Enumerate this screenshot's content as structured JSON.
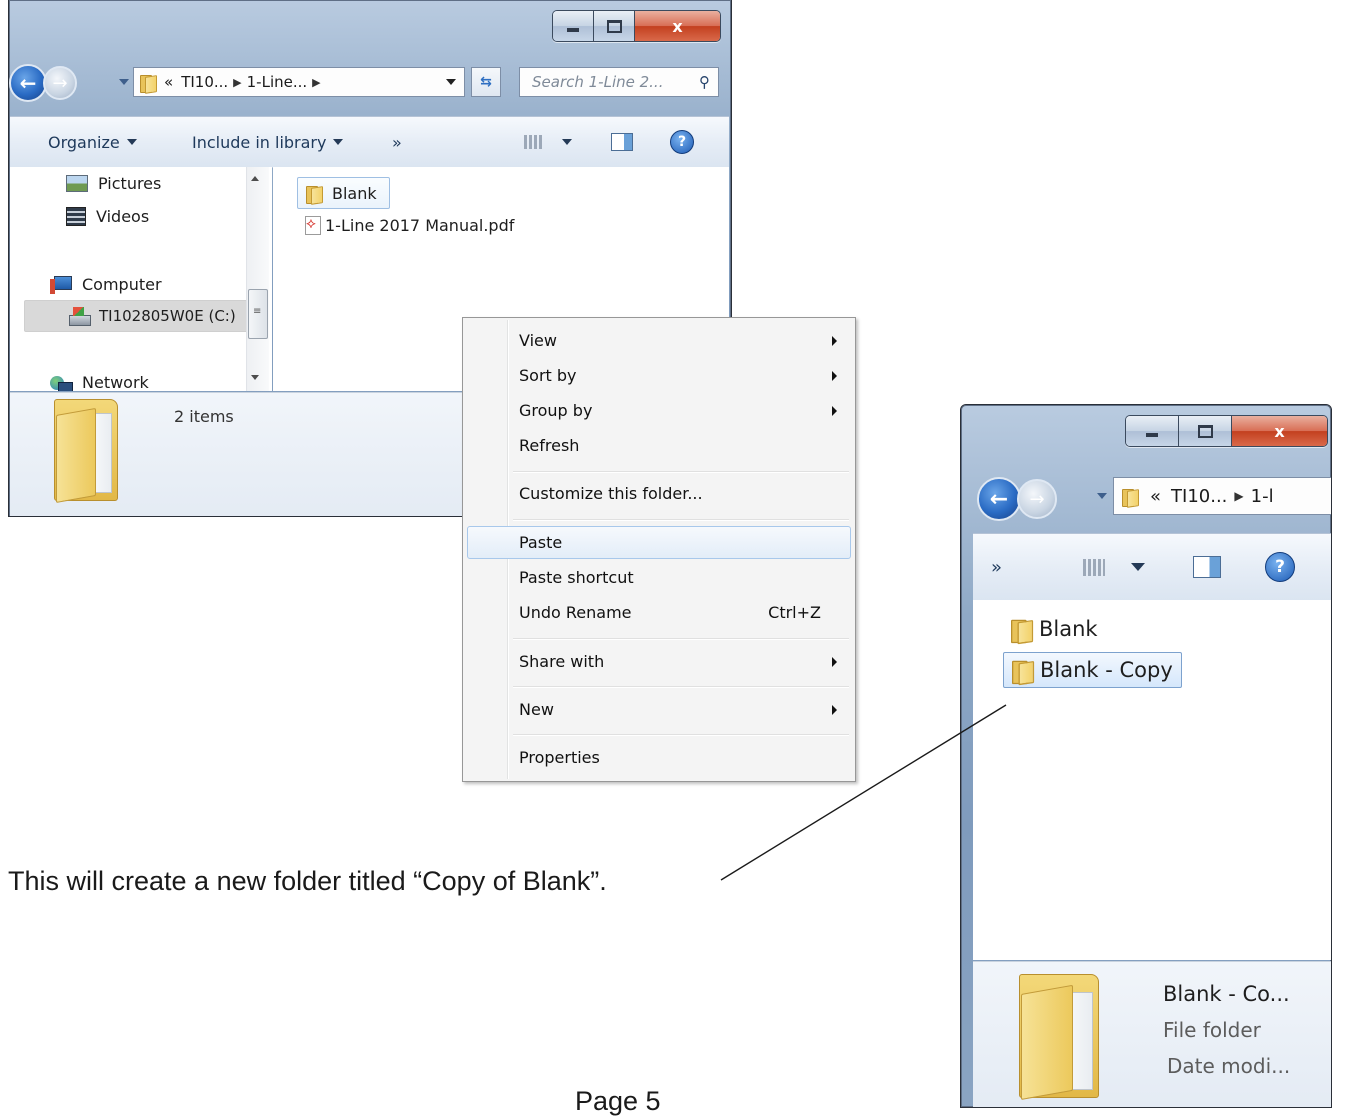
{
  "window1": {
    "address_overflow": "«",
    "address_crumbs": [
      "TI10...",
      "1-Line..."
    ],
    "search_placeholder": "Search 1-Line 2...",
    "toolbar": {
      "organize": "Organize",
      "include_in_library": "Include in library",
      "more": "»"
    },
    "nav_tree": {
      "pictures": "Pictures",
      "videos": "Videos",
      "computer": "Computer",
      "drive": "TI102805W0E (C:)",
      "network": "Network"
    },
    "files": [
      {
        "name": "Blank",
        "type": "folder"
      },
      {
        "name": "1-Line 2017 Manual.pdf",
        "type": "pdf"
      }
    ],
    "status": {
      "item_count": "2 items"
    },
    "caption_buttons": {
      "close": "x"
    }
  },
  "context_menu": {
    "items": [
      {
        "label": "View",
        "submenu": true
      },
      {
        "label": "Sort by",
        "submenu": true
      },
      {
        "label": "Group by",
        "submenu": true
      },
      {
        "label": "Refresh"
      },
      {
        "label": "Customize this folder..."
      },
      {
        "label": "Paste",
        "highlighted": true
      },
      {
        "label": "Paste shortcut"
      },
      {
        "label": "Undo Rename",
        "shortcut": "Ctrl+Z"
      },
      {
        "label": "Share with",
        "submenu": true
      },
      {
        "label": "New",
        "submenu": true
      },
      {
        "label": "Properties"
      }
    ]
  },
  "window2": {
    "address_overflow": "«",
    "address_crumbs": [
      "TI10...",
      "1-l"
    ],
    "toolbar": {
      "more": "»"
    },
    "files": [
      {
        "name": "Blank",
        "type": "folder"
      },
      {
        "name": "Blank - Copy",
        "type": "folder",
        "selected": true
      }
    ],
    "details": {
      "name": "Blank - Co...",
      "type": "File folder",
      "date": "Date modi..."
    },
    "caption_buttons": {
      "close": "x"
    }
  },
  "annotation": {
    "text": "This will create a new folder titled “Copy of Blank”."
  },
  "page": {
    "number": "Page 5"
  }
}
